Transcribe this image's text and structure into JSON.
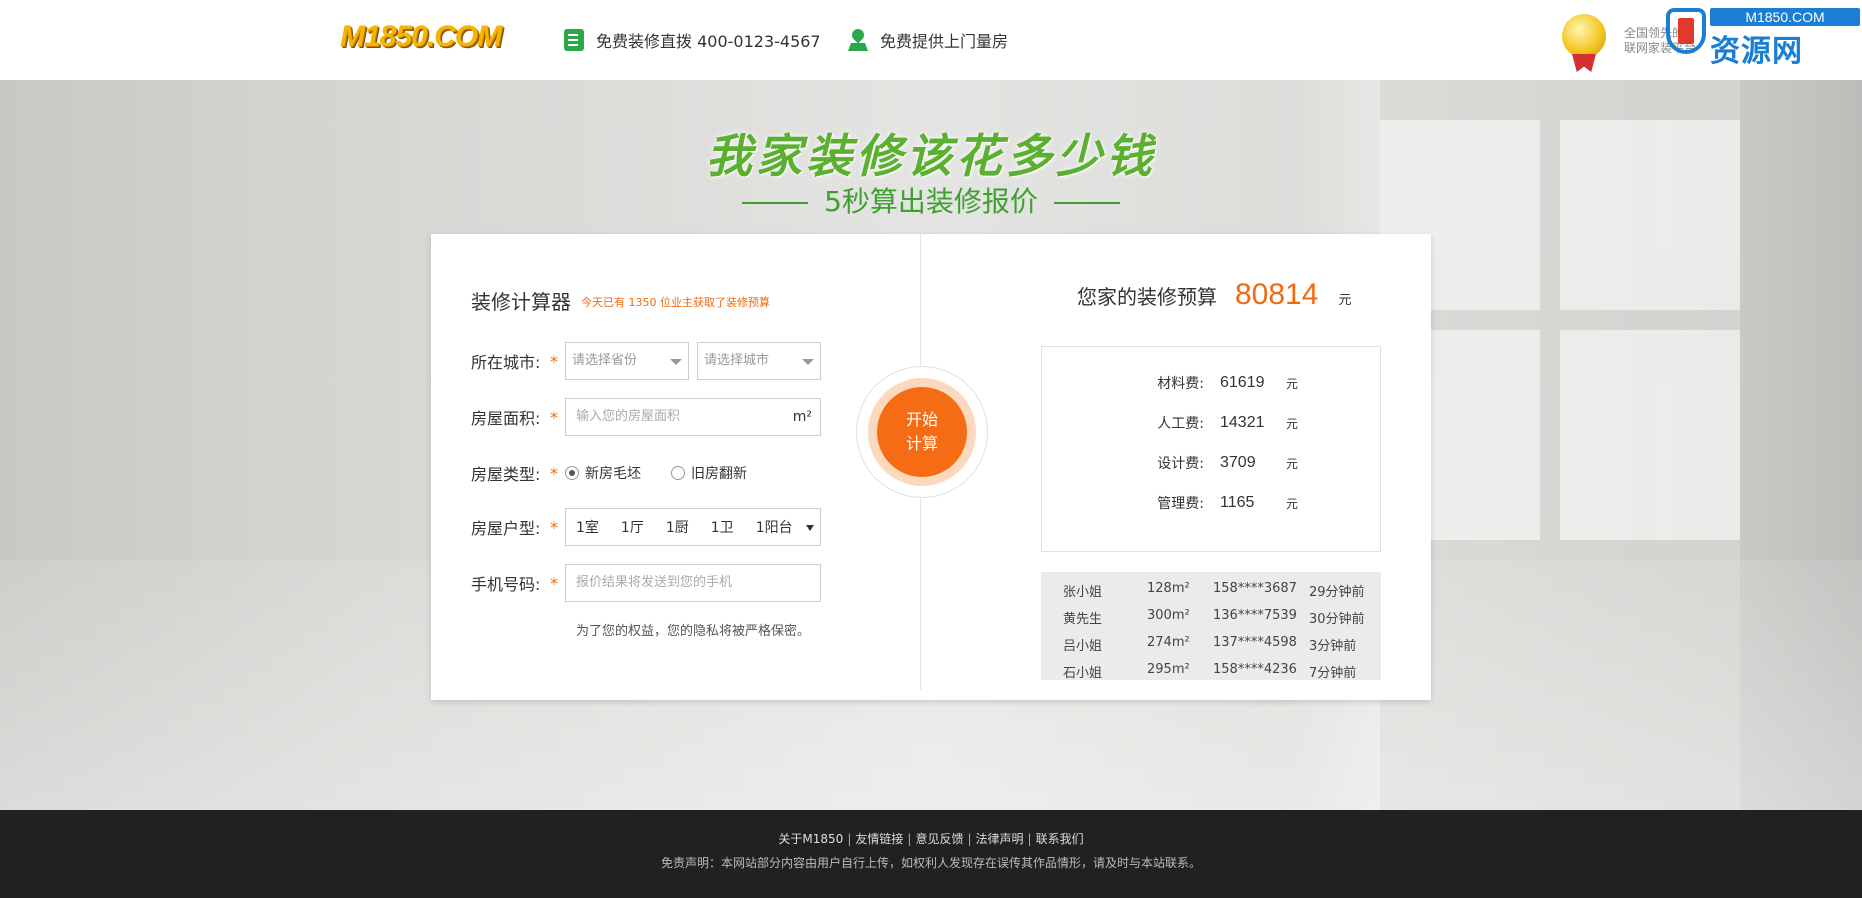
{
  "header": {
    "logo": "M1850.COM",
    "phone_text": "免费装修直拨 400-0123-4567",
    "measure_text": "免费提供上门量房",
    "brand_small_line1": "全国领先的",
    "brand_small_line2": "联网家装平台",
    "brand_url": "M1850.COM",
    "brand_cn": "资源网"
  },
  "hero": {
    "title": "我家装修该花多少钱",
    "subtitle": "5秒算出装修报价"
  },
  "calculator": {
    "title": "装修计算器",
    "note": "今天已有 1350 位业主获取了装修预算",
    "city_label": "所在城市:",
    "province_placeholder": "请选择省份",
    "city_placeholder": "请选择城市",
    "area_label": "房屋面积:",
    "area_placeholder": "输入您的房屋面积",
    "area_unit": "m²",
    "type_label": "房屋类型:",
    "type_options": [
      "新房毛坯",
      "旧房翻新"
    ],
    "layout_label": "房屋户型:",
    "layout_parts": [
      "1室",
      "1厅",
      "1厨",
      "1卫",
      "1阳台"
    ],
    "phone_label": "手机号码:",
    "phone_placeholder": "报价结果将发送到您的手机",
    "privacy": "为了您的权益，您的隐私将被严格保密。",
    "required_mark": "*",
    "start_line1": "开始",
    "start_line2": "计算"
  },
  "result": {
    "label": "您家的装修预算",
    "value": "80814",
    "unit": "元",
    "fees": [
      {
        "label": "材料费:",
        "value": "61619",
        "unit": "元"
      },
      {
        "label": "人工费:",
        "value": "14321",
        "unit": "元"
      },
      {
        "label": "设计费:",
        "value": "3709",
        "unit": "元"
      },
      {
        "label": "管理费:",
        "value": "1165",
        "unit": "元"
      }
    ],
    "records": [
      {
        "name": "张小姐",
        "area": "128m²",
        "phone": "158****3687",
        "time": "29分钟前"
      },
      {
        "name": "黄先生",
        "area": "300m²",
        "phone": "136****7539",
        "time": "30分钟前"
      },
      {
        "name": "吕小姐",
        "area": "274m²",
        "phone": "137****4598",
        "time": "3分钟前"
      },
      {
        "name": "石小姐",
        "area": "295m²",
        "phone": "158****4236",
        "time": "7分钟前"
      }
    ]
  },
  "footer": {
    "links": [
      "关于M1850",
      "友情链接",
      "意见反馈",
      "法律声明",
      "联系我们"
    ],
    "separator": "|",
    "disclaimer": "免责声明：本网站部分内容由用户自行上传，如权利人发现存在误传其作品情形，请及时与本站联系。"
  },
  "colors": {
    "accent_orange": "#f56c14",
    "title_green": "#5cb030",
    "brand_blue": "#1a7fd4",
    "footer_bg": "#212121"
  }
}
